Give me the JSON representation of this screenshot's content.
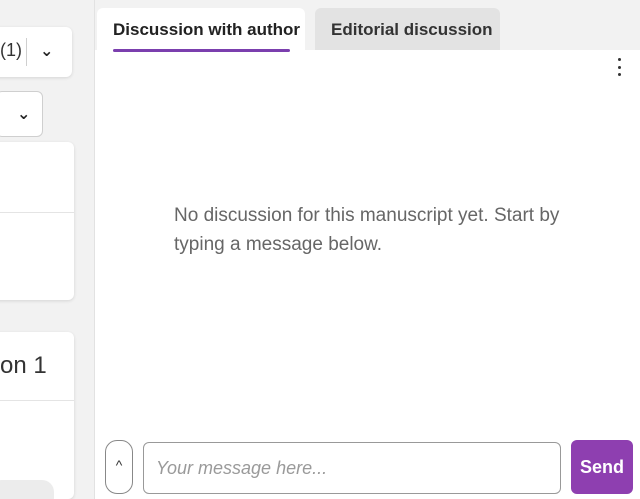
{
  "left": {
    "count_text": "(1)",
    "section_title": "on 1"
  },
  "discussion": {
    "tabs": [
      {
        "label": "Discussion with author",
        "active": true
      },
      {
        "label": "Editorial discussion",
        "active": false
      }
    ],
    "empty_message": "No discussion for this manuscript yet. Start by typing a message below.",
    "input": {
      "placeholder": "Your message here...",
      "value": ""
    },
    "send_label": "Send",
    "expand_icon": "^"
  },
  "colors": {
    "accent": "#8e3fb0",
    "tab_underline": "#7b3fae"
  },
  "icons": {
    "chevron": "chevron-down-icon",
    "kebab": "kebab-menu-icon",
    "expand": "chevron-up-icon"
  }
}
